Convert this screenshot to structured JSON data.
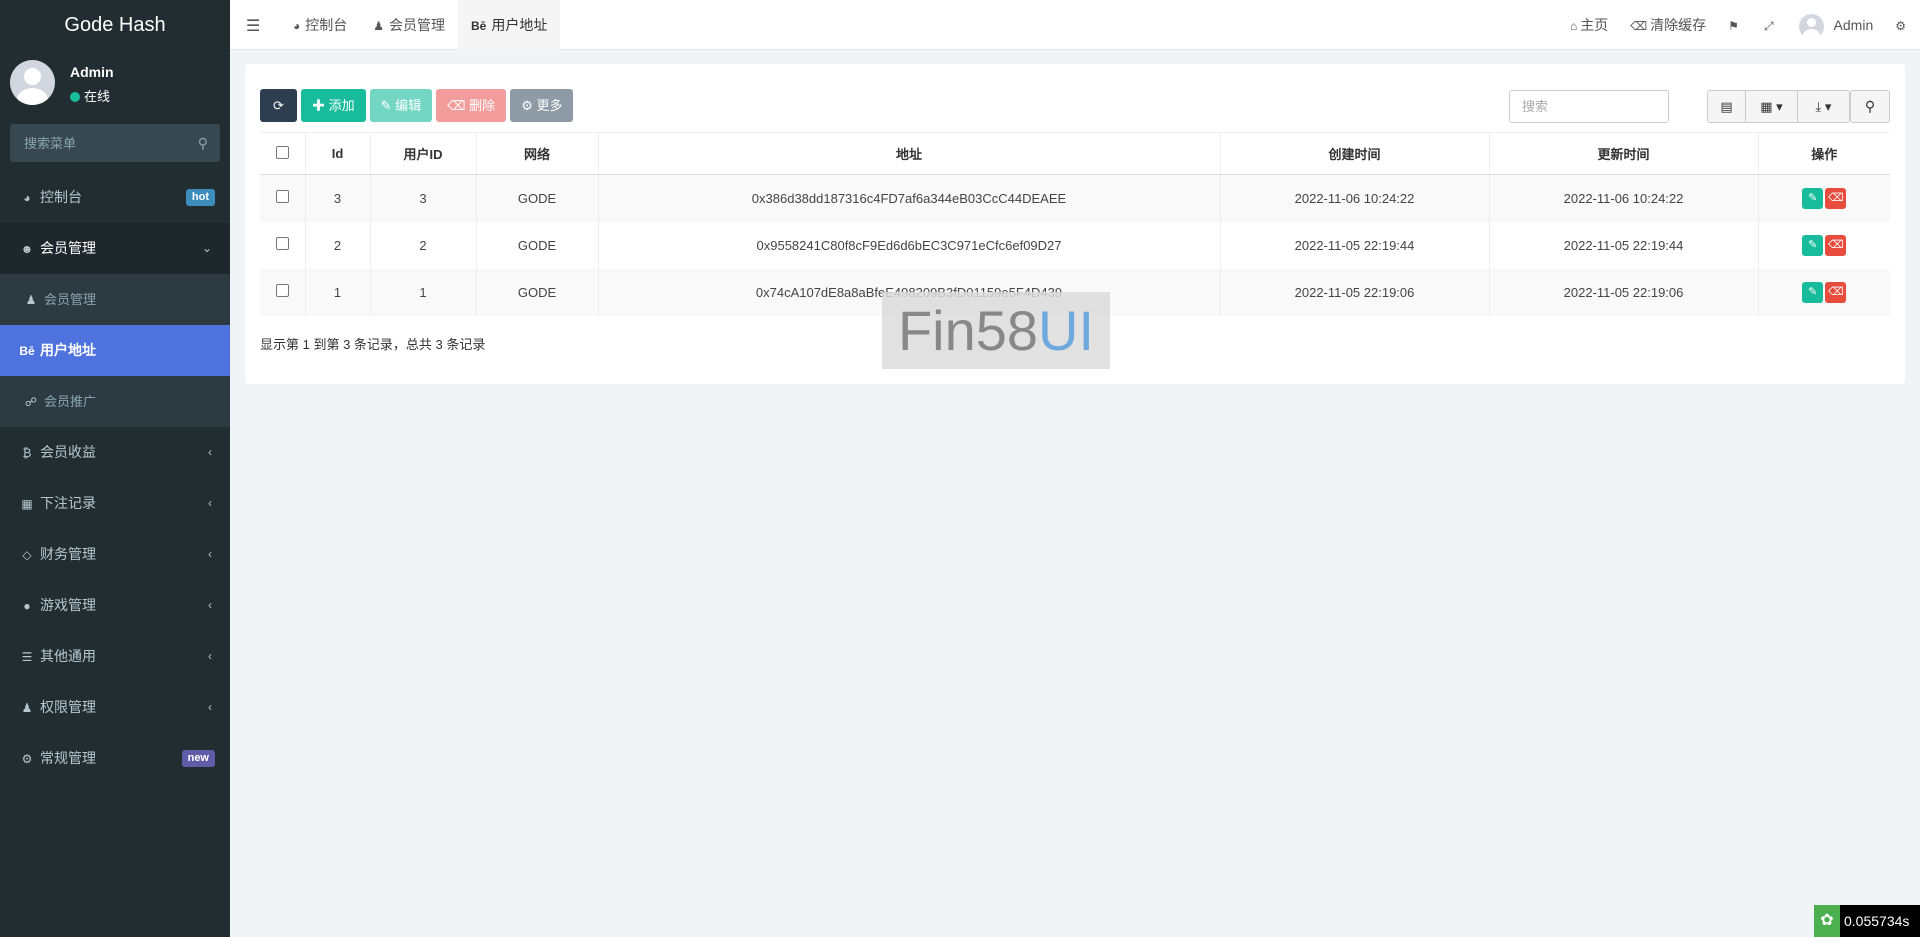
{
  "brand": "Gode Hash",
  "user": {
    "name": "Admin",
    "status": "在线"
  },
  "sidebar_search": {
    "placeholder": "搜索菜单"
  },
  "menu": [
    {
      "label": "控制台",
      "badge": "hot"
    },
    {
      "label": "会员管理"
    },
    {
      "label": "会员管理"
    },
    {
      "label": "用户地址",
      "prefix": "Bē"
    },
    {
      "label": "会员推广"
    },
    {
      "label": "会员收益"
    },
    {
      "label": "下注记录"
    },
    {
      "label": "财务管理"
    },
    {
      "label": "游戏管理"
    },
    {
      "label": "其他通用"
    },
    {
      "label": "权限管理"
    },
    {
      "label": "常规管理",
      "badge": "new"
    }
  ],
  "tabs": [
    {
      "label": "控制台"
    },
    {
      "label": "会员管理"
    },
    {
      "label": "用户地址",
      "prefix": "Bē"
    }
  ],
  "topnav": {
    "home": "主页",
    "clear_cache": "清除缓存",
    "admin": "Admin"
  },
  "toolbar": {
    "add": "添加",
    "edit": "编辑",
    "delete": "删除",
    "more": "更多"
  },
  "search": {
    "placeholder": "搜索"
  },
  "table": {
    "headers": [
      "Id",
      "用户ID",
      "网络",
      "地址",
      "创建时间",
      "更新时间",
      "操作"
    ],
    "rows": [
      {
        "id": "3",
        "user_id": "3",
        "network": "GODE",
        "address": "0x386d38dd187316c4FD7af6a344eB03CcC44DEAEE",
        "created": "2022-11-06 10:24:22",
        "updated": "2022-11-06 10:24:22"
      },
      {
        "id": "2",
        "user_id": "2",
        "network": "GODE",
        "address": "0x9558241C80f8cF9Ed6d6bEC3C971eCfc6ef09D27",
        "created": "2022-11-05 22:19:44",
        "updated": "2022-11-05 22:19:44"
      },
      {
        "id": "1",
        "user_id": "1",
        "network": "GODE",
        "address": "0x74cA107dE8a8aBfeE498209B3fD01159e5F4D439",
        "created": "2022-11-05 22:19:06",
        "updated": "2022-11-05 22:19:06"
      }
    ]
  },
  "page_info": "显示第 1 到第 3 条记录，总共 3 条记录",
  "watermark": {
    "main": "Fin58",
    "accent": "UI"
  },
  "perf": "0.055734s",
  "colors": {
    "sidebar": "#222d32",
    "active": "#4e73df",
    "success": "#18bc9c",
    "danger": "#e74c3c"
  }
}
